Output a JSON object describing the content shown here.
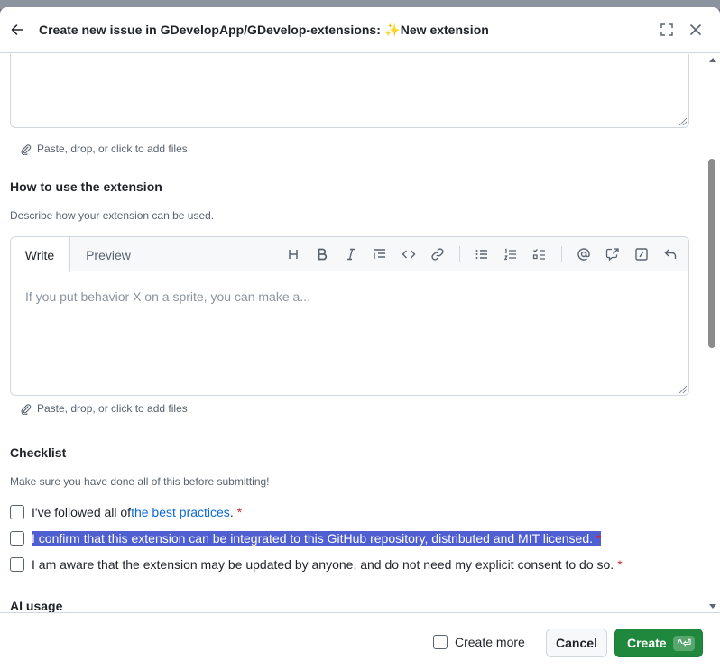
{
  "dialog": {
    "title_prefix": "Create new issue in GDevelopApp/GDevelop-extensions: ",
    "title_emoji": "✨",
    "title_suffix": "New extension"
  },
  "upper_field": {
    "attach_label": "Paste, drop, or click to add files"
  },
  "usage_field": {
    "label": "How to use the extension",
    "description": "Describe how your extension can be used.",
    "tabs": {
      "write": "Write",
      "preview": "Preview"
    },
    "placeholder": "If you put behavior X on a sprite, you can make a...",
    "attach_label": "Paste, drop, or click to add files",
    "toolbar": [
      "heading-icon",
      "bold-icon",
      "italic-icon",
      "quote-icon",
      "code-icon",
      "link-icon",
      "bulleted-list-icon",
      "numbered-list-icon",
      "task-list-icon",
      "mention-icon",
      "cross-reference-icon",
      "slash-commands-icon",
      "undo-icon"
    ]
  },
  "checklist": {
    "label": "Checklist",
    "description": "Make sure you have done all of this before submitting!",
    "items": [
      {
        "prefix": "I've followed all of ",
        "link": "the best practices",
        "suffix": ".",
        "required": "*",
        "checked": false
      },
      {
        "text": "I confirm that this extension can be integrated to this GitHub repository, distributed and MIT licensed.",
        "required": "*",
        "checked": false,
        "selected": true
      },
      {
        "text": "I am aware that the extension may be updated by anyone, and do not need my explicit consent to do so.",
        "required": "*",
        "checked": false
      }
    ]
  },
  "next_section": {
    "label": "AI usage"
  },
  "footer": {
    "create_more": "Create more",
    "cancel": "Cancel",
    "create": "Create",
    "create_shortcut": "^⏎"
  },
  "colors": {
    "primary": "#1f883d",
    "link": "#0969da",
    "required": "#d1242f",
    "selection": "#4f5fd1"
  }
}
